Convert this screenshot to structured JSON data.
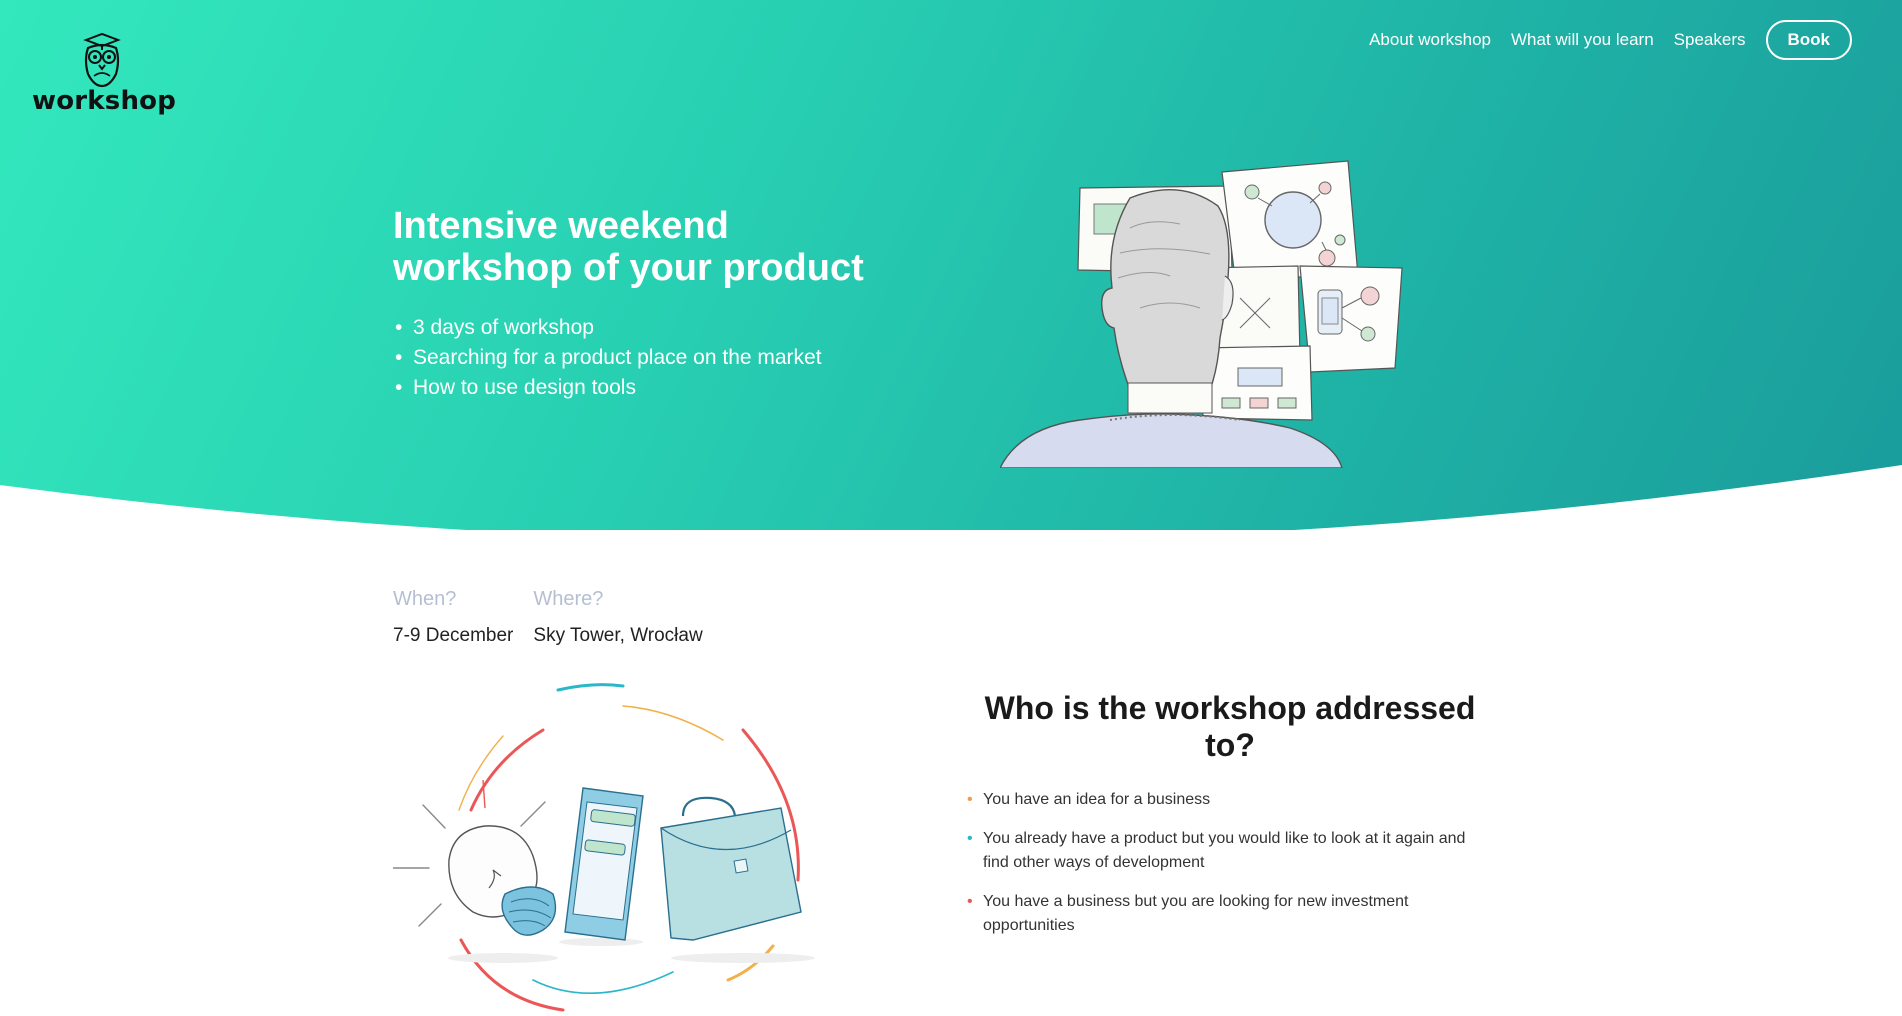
{
  "brand": {
    "name": "workshop"
  },
  "nav": {
    "items": [
      {
        "label": "About workshop"
      },
      {
        "label": "What will you learn"
      },
      {
        "label": "Speakers"
      }
    ],
    "book_label": "Book"
  },
  "hero": {
    "title_line1": "Intensive weekend",
    "title_line2": "workshop of your product",
    "bullets": [
      "3 days of workshop",
      "Searching for a product place on the market",
      "How to use design tools"
    ]
  },
  "event": {
    "when_label": "When?",
    "when_value": "7-9 December",
    "where_label": "Where?",
    "where_value": "Sky Tower, Wrocław"
  },
  "audience": {
    "title": "Who is the workshop addressed to?",
    "items": [
      {
        "text": "You have an idea for a business",
        "dot_color": "#f2994a"
      },
      {
        "text": "You already have a product but you would like to look at it again and find other ways of development",
        "dot_color": "#2ab7c9"
      },
      {
        "text": "You have a business but you are looking for new investment opportunities",
        "dot_color": "#eb5757"
      }
    ]
  },
  "colors": {
    "hero_gradient_start": "#33e8bd",
    "hero_gradient_end": "#1a9c9c",
    "label_color": "#b6bfd2"
  },
  "icons": {
    "logo": "owl-icon",
    "hero": "man-with-diagrams-illustration",
    "bottom": "bulb-phone-briefcase-illustration"
  }
}
